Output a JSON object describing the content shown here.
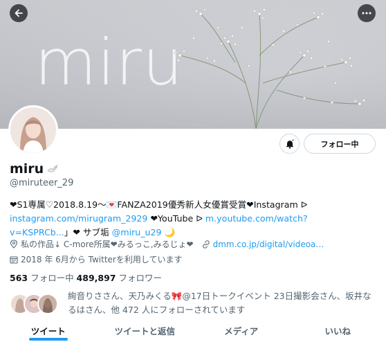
{
  "banner": {
    "word": "miru"
  },
  "header": {
    "back_icon": "arrow-left-icon",
    "more_icon": "more-horizontal-icon"
  },
  "actions": {
    "notify_icon": "bell-icon",
    "follow_label": "フォロー中"
  },
  "profile": {
    "name": "miru",
    "handle": "@miruteer_29",
    "bio": {
      "line1": "❤S1専属♡2018.8.19〜💌FANZA2019優秀新人女優賞受賞❤Instagram ᐅ",
      "line2_link1": "instagram.com/mirugram_2929",
      "line2_text": " ❤YouTube ᐅ ",
      "line2_link2": "m.youtube.com/watch?",
      "line3_link": "v=KSPRCb...",
      "line3_text": "」❤ サブ垢 ",
      "line3_mention": "@miru_u29",
      "line3_end": " 🌙"
    },
    "location": "私の作品↓ C-more所属❤みるっこ,みるじょ❤",
    "website": "dmm.co.jp/digital/videoa…",
    "joined": "2018 年 6月から Twitterを利用しています",
    "following_count": "563",
    "following_label": " フォロー中 ",
    "followers_count": "489,897",
    "followers_label": " フォロワー",
    "followed_by": "絢音りささん、天乃みくる🎀@17日トークイベント 23日撮影会さん、坂井なるはさん、他 472 人にフォローされています"
  },
  "tabs": [
    "ツイート",
    "ツイートと返信",
    "メディア",
    "いいね"
  ],
  "colors": {
    "accent": "#1d9bf0",
    "text": "#0f1419",
    "muted": "#536471"
  }
}
